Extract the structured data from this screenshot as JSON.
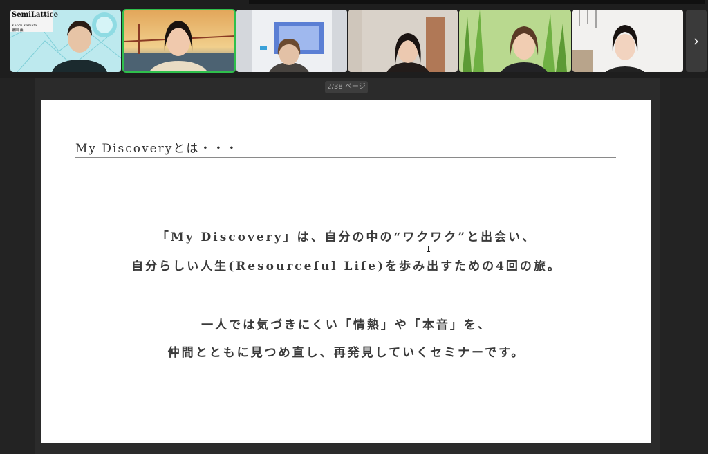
{
  "participants": [
    {
      "brand": "SemiLattice",
      "name_line1": "Kaoru Kamata",
      "name_line2": "鎌田 薫"
    },
    {},
    {},
    {},
    {},
    {}
  ],
  "nav": {
    "next_glyph": "›"
  },
  "page_indicator": "2/38 ページ",
  "slide": {
    "title": "My Discoveryとは・・・",
    "lines": [
      "「My Discovery」は、自分の中の“ワクワク”と出会い、",
      "自分らしい人生(Resourceful Life)を歩み出すための4回の旅。",
      "一人では気づきにくい「情熱」や「本音」を、",
      "仲間とともに見つめ直し、再発見していくセミナーです。"
    ]
  },
  "colors": {
    "active_speaker_border": "#2fbf4c",
    "slide_background": "#ffffff",
    "app_background": "#232323"
  }
}
